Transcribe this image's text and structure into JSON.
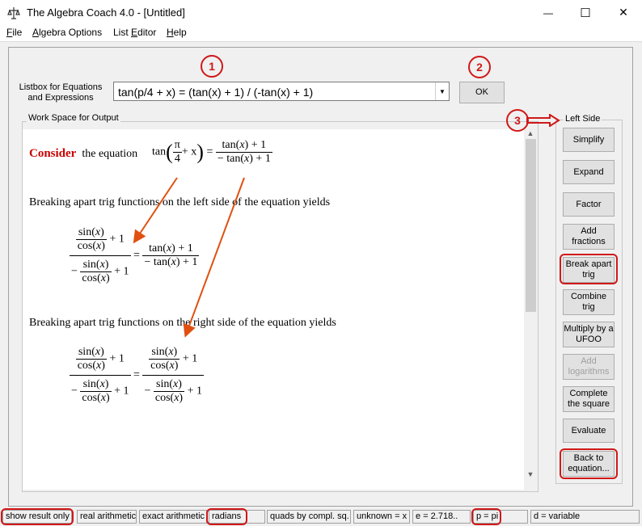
{
  "window": {
    "title": "The Algebra Coach 4.0 - [Untitled]",
    "controls": {
      "minimize": "—",
      "maximize": "☐",
      "close": "✕"
    }
  },
  "menu": {
    "file": {
      "accel": "F",
      "rest": "ile"
    },
    "algebra_options": {
      "accel": "A",
      "rest": "lgebra Options"
    },
    "list_editor": {
      "pre": "List ",
      "accel": "E",
      "rest": "ditor"
    },
    "help": {
      "accel": "H",
      "rest": "elp"
    }
  },
  "listbox": {
    "label": "Listbox for Equations and Expressions",
    "value": "tan(p/4 + x) = (tan(x) + 1) / (-tan(x) + 1)"
  },
  "ok_label": "OK",
  "workspace": {
    "title": "Work Space for Output",
    "consider_word": "Consider",
    "consider_rest": "the equation",
    "line1": "Breaking apart trig functions on the left side of the equation yields",
    "line2": "Breaking apart trig functions on the right side of the equation yields",
    "math": {
      "tan": "tan",
      "sin": "sin",
      "cos": "cos",
      "pi": "π",
      "four": "4",
      "x": "x",
      "plus_x": "+ x",
      "plus1": "+ 1",
      "eq": "=",
      "minus": "−"
    }
  },
  "side_panel": {
    "title": "Left Side",
    "buttons": [
      {
        "label": "Simplify",
        "enabled": true
      },
      {
        "label": "Expand",
        "enabled": true
      },
      {
        "label": "Factor",
        "enabled": true
      },
      {
        "label": "Add fractions",
        "enabled": true
      },
      {
        "label": "Break apart trig",
        "enabled": true
      },
      {
        "label": "Combine trig",
        "enabled": true
      },
      {
        "label": "Multiply by a UFOO",
        "enabled": true
      },
      {
        "label": "Add logarithms",
        "enabled": false
      },
      {
        "label": "Complete the square",
        "enabled": true
      },
      {
        "label": "Evaluate",
        "enabled": true
      },
      {
        "label": "Back to equation...",
        "enabled": true
      }
    ]
  },
  "status_bar": [
    "show result only",
    "real arithmetic",
    "exact arithmetic",
    "radians",
    "quads by compl. sq.",
    "unknown = x",
    "e = 2.718..",
    "p = pi",
    "d = variable"
  ],
  "annotations": {
    "one": "1",
    "two": "2",
    "three": "3"
  },
  "colors": {
    "annotation_red": "#d01818",
    "consider_red": "#c80000",
    "arrow_orange": "#e05010"
  }
}
